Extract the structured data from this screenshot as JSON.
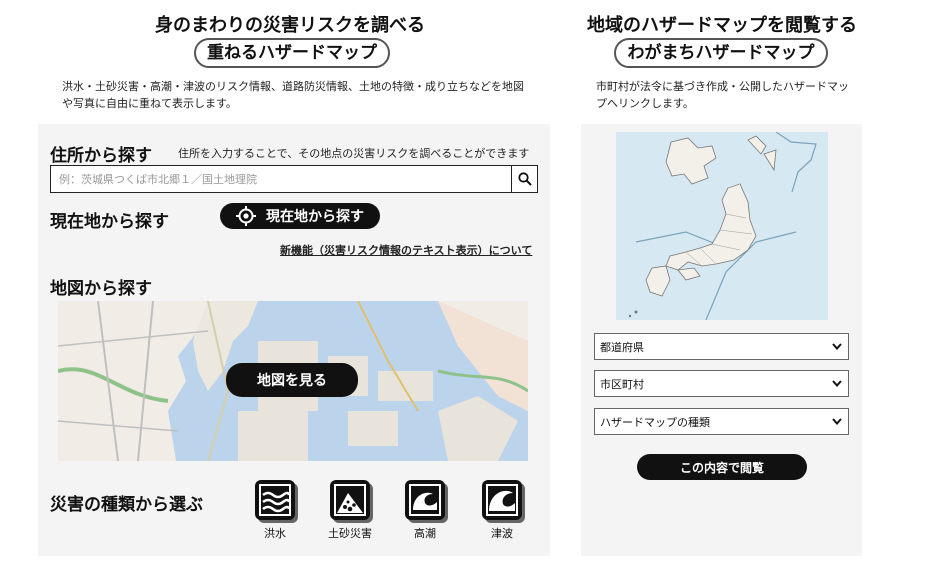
{
  "left": {
    "heading": "身のまわりの災害リスクを調べる",
    "pill": "重ねるハザードマップ",
    "description": "洪水・土砂災害・高潮・津波のリスク情報、道路防災情報、土地の特徴・成り立ちなどを地図や写真に自由に重ねて表示します。",
    "address": {
      "title": "住所から探す",
      "note": "住所を入力することで、その地点の災害リスクを調べることができます",
      "placeholder": "例：茨城県つくば市北郷１／国土地理院"
    },
    "current": {
      "title": "現在地から探す",
      "button": "現在地から探す"
    },
    "new_feature_link": "新機能（災害リスク情報のテキスト表示）について",
    "map": {
      "title": "地図から探す",
      "button": "地図を見る"
    },
    "hazard": {
      "title": "災害の種類から選ぶ",
      "items": [
        {
          "label": "洪水",
          "icon": "flood-icon"
        },
        {
          "label": "土砂災害",
          "icon": "landslide-icon"
        },
        {
          "label": "高潮",
          "icon": "storm-surge-icon"
        },
        {
          "label": "津波",
          "icon": "tsunami-icon"
        }
      ]
    }
  },
  "right": {
    "heading": "地域のハザードマップを閲覧する",
    "pill": "わがまちハザードマップ",
    "description": "市町村が法令に基づき作成・公開したハザードマップへリンクします。",
    "selects": {
      "prefecture": "都道府県",
      "municipality": "市区町村",
      "map_type": "ハザードマップの種類"
    },
    "view_button": "この内容で閲覧"
  },
  "colors": {
    "accent": "#111111",
    "panel": "#f4f4f4",
    "water": "#bcd3ec",
    "japan_sea": "#d6e9f2"
  }
}
